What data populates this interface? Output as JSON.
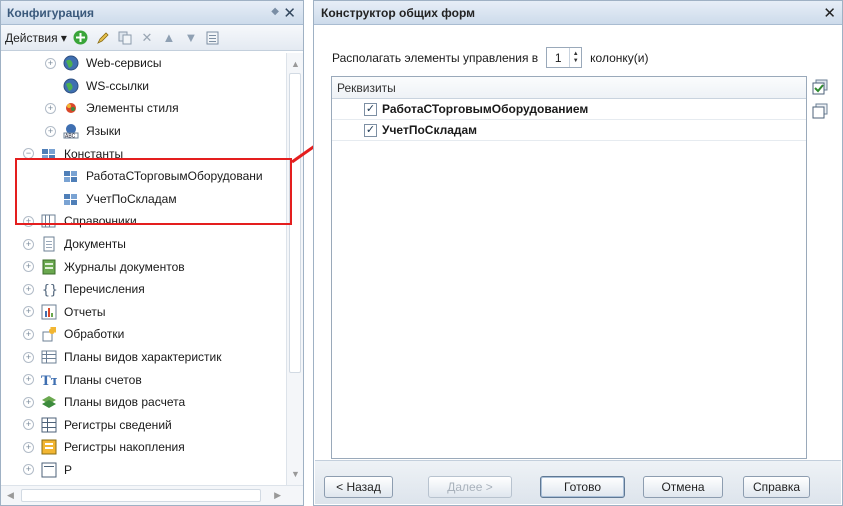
{
  "left_panel": {
    "title": "Конфигурация",
    "actions_label": "Действия",
    "tree": [
      {
        "label": "Web-сервисы",
        "icon": "globe-icon",
        "expander": "+",
        "indent": 1
      },
      {
        "label": "WS-ссылки",
        "icon": "globe-icon",
        "expander": "",
        "indent": 1
      },
      {
        "label": "Элементы стиля",
        "icon": "style-icon",
        "expander": "+",
        "indent": 1
      },
      {
        "label": "Языки",
        "icon": "language-icon",
        "expander": "+",
        "indent": 1
      },
      {
        "label": "Константы",
        "icon": "constant-icon",
        "expander": "−",
        "indent": 0
      },
      {
        "label": "РаботаСТорговымОборудовани",
        "icon": "constant-icon",
        "expander": "",
        "indent": 1
      },
      {
        "label": "УчетПоСкладам",
        "icon": "constant-icon",
        "expander": "",
        "indent": 1
      },
      {
        "label": "Справочники",
        "icon": "catalog-icon",
        "expander": "+",
        "indent": 0
      },
      {
        "label": "Документы",
        "icon": "document-icon",
        "expander": "+",
        "indent": 0
      },
      {
        "label": "Журналы документов",
        "icon": "journal-icon",
        "expander": "+",
        "indent": 0
      },
      {
        "label": "Перечисления",
        "icon": "enum-icon",
        "expander": "+",
        "indent": 0
      },
      {
        "label": "Отчеты",
        "icon": "report-icon",
        "expander": "+",
        "indent": 0
      },
      {
        "label": "Обработки",
        "icon": "dataprocessor-icon",
        "expander": "+",
        "indent": 0
      },
      {
        "label": "Планы видов характеристик",
        "icon": "chart-types-icon",
        "expander": "+",
        "indent": 0
      },
      {
        "label": "Планы счетов",
        "icon": "chart-of-accounts-icon",
        "expander": "+",
        "indent": 0
      },
      {
        "label": "Планы видов расчета",
        "icon": "calc-types-icon",
        "expander": "+",
        "indent": 0
      },
      {
        "label": "Регистры сведений",
        "icon": "info-register-icon",
        "expander": "+",
        "indent": 0
      },
      {
        "label": "Регистры накопления",
        "icon": "accum-register-icon",
        "expander": "+",
        "indent": 0
      },
      {
        "label": "Р",
        "icon": "register-icon",
        "expander": "+",
        "indent": 0
      }
    ]
  },
  "dialog": {
    "title": "Конструктор общих форм",
    "option_prefix": "Располагать элементы управления в",
    "columns_value": "1",
    "option_suffix": "колонку(и)",
    "list_header": "Реквизиты",
    "items": [
      {
        "label": "РаботаСТорговымОборудованием",
        "checked": true
      },
      {
        "label": "УчетПоСкладам",
        "checked": true
      }
    ],
    "buttons": {
      "back": "< Назад",
      "next": "Далее >",
      "done": "Готово",
      "cancel": "Отмена",
      "help": "Справка"
    }
  },
  "colors": {
    "highlight": "#e41e1e",
    "title_bar": "#cddbeb"
  }
}
